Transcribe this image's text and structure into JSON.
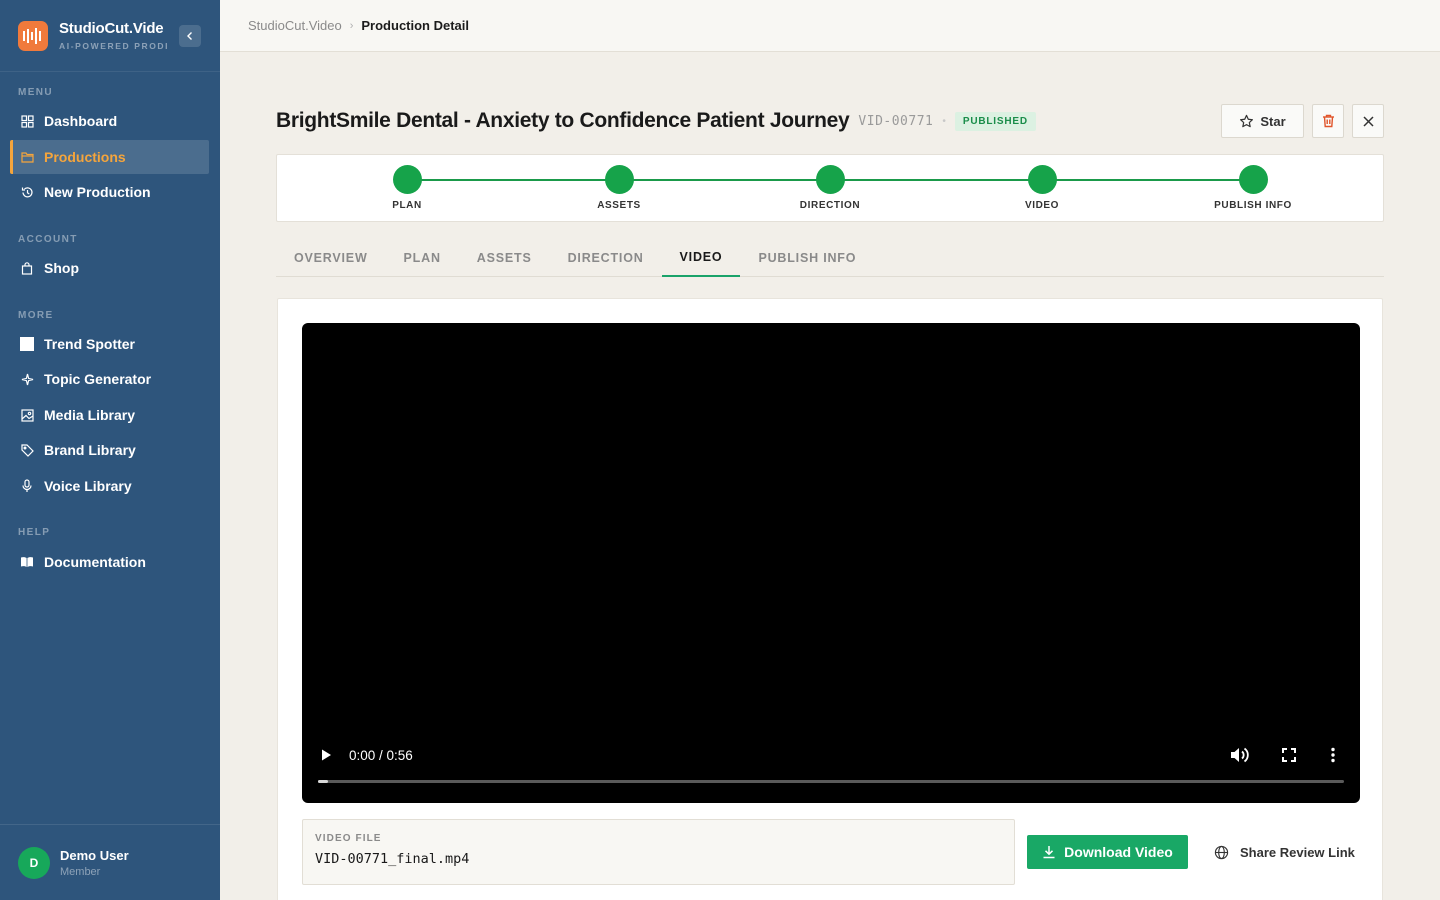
{
  "app": {
    "name": "StudioCut.Video",
    "brand_display": "StudioCut.Vide",
    "tagline": "AI-POWERED PRODI"
  },
  "sidebar": {
    "sections": [
      {
        "label": "MENU",
        "items": [
          {
            "label": "Dashboard",
            "icon": "grid-icon"
          },
          {
            "label": "Productions",
            "icon": "folder-icon",
            "active": true
          },
          {
            "label": "New Production",
            "icon": "history-icon"
          }
        ]
      },
      {
        "label": "ACCOUNT",
        "items": [
          {
            "label": "Shop",
            "icon": "bag-icon"
          }
        ]
      },
      {
        "label": "MORE",
        "items": [
          {
            "label": "Trend Spotter",
            "icon": "square-icon"
          },
          {
            "label": "Topic Generator",
            "icon": "sparkle-icon"
          },
          {
            "label": "Media Library",
            "icon": "image-icon"
          },
          {
            "label": "Brand Library",
            "icon": "tag-icon"
          },
          {
            "label": "Voice Library",
            "icon": "mic-icon"
          }
        ]
      },
      {
        "label": "HELP",
        "items": [
          {
            "label": "Documentation",
            "icon": "book-icon"
          }
        ]
      }
    ],
    "user": {
      "initial": "D",
      "name": "Demo User",
      "role": "Member"
    }
  },
  "breadcrumb": {
    "root": "StudioCut.Video",
    "current": "Production Detail"
  },
  "production": {
    "title": "BrightSmile Dental - Anxiety to Confidence Patient Journey",
    "id": "VID-00771",
    "status": "PUBLISHED",
    "star_label": "Star"
  },
  "stepper": {
    "steps": [
      "PLAN",
      "ASSETS",
      "DIRECTION",
      "VIDEO",
      "PUBLISH INFO"
    ],
    "completed": 5
  },
  "tabs": {
    "items": [
      "OVERVIEW",
      "PLAN",
      "ASSETS",
      "DIRECTION",
      "VIDEO",
      "PUBLISH INFO"
    ],
    "active": "VIDEO"
  },
  "player": {
    "time": "0:00 / 0:56",
    "progress": 0.01
  },
  "file": {
    "label": "VIDEO FILE",
    "name": "VID-00771_final.mp4",
    "download_label": "Download Video",
    "share_label": "Share Review Link"
  },
  "colors": {
    "sidebar_bg": "#2e557c",
    "accent_orange": "#f5a53c",
    "logo": "#f07a3c",
    "success_green": "#16a34a",
    "button_green": "#19a866",
    "page_bg": "#f2efe9"
  }
}
